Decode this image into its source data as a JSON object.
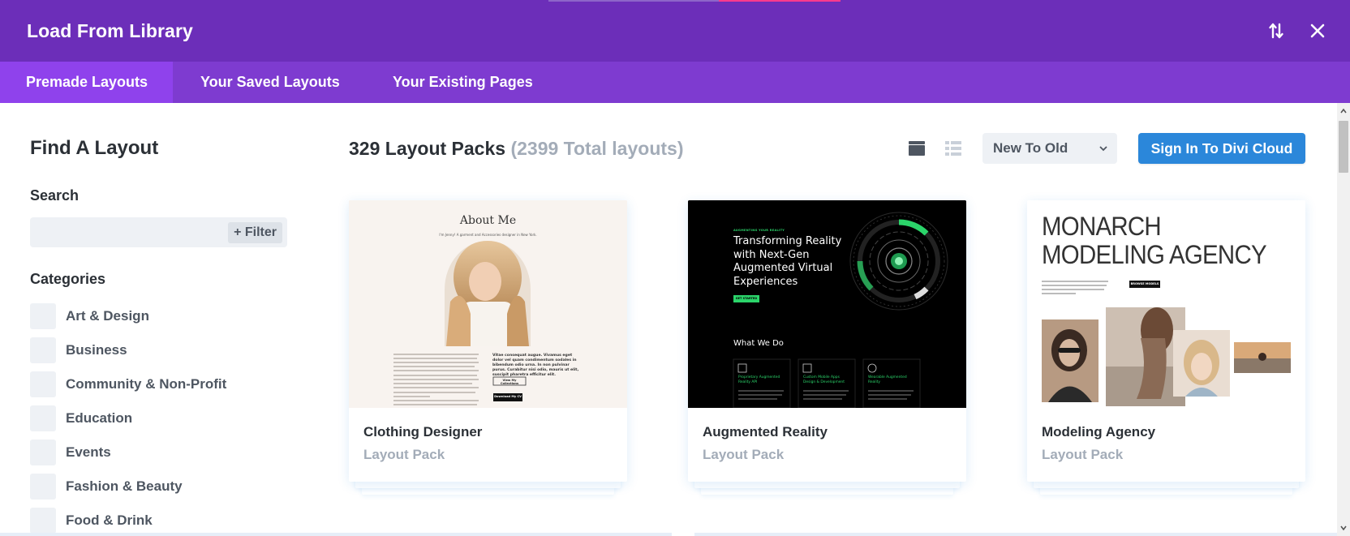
{
  "window": {
    "title": "Load From Library",
    "sort_toggle_icon": "sort-arrows-icon",
    "close_icon": "close-icon"
  },
  "tabs": [
    {
      "label": "Premade Layouts",
      "active": true
    },
    {
      "label": "Your Saved Layouts",
      "active": false
    },
    {
      "label": "Your Existing Pages",
      "active": false
    }
  ],
  "sidebar": {
    "heading": "Find A Layout",
    "search_label": "Search",
    "search_value": "",
    "filter_label": "+ Filter",
    "categories_label": "Categories",
    "categories": [
      {
        "label": "Art & Design",
        "checked": false
      },
      {
        "label": "Business",
        "checked": false
      },
      {
        "label": "Community & Non-Profit",
        "checked": false
      },
      {
        "label": "Education",
        "checked": false
      },
      {
        "label": "Events",
        "checked": false
      },
      {
        "label": "Fashion & Beauty",
        "checked": false
      },
      {
        "label": "Food & Drink",
        "checked": false
      }
    ]
  },
  "main": {
    "pack_count": "329 Layout Packs",
    "total_layouts": "(2399 Total layouts)",
    "views": {
      "grid_icon": "grid-view-icon",
      "list_icon": "list-view-icon",
      "active": "grid"
    },
    "sort": {
      "selected": "New To Old"
    },
    "cloud_button": "Sign In To Divi Cloud",
    "cards": [
      {
        "name": "Clothing Designer",
        "type": "Layout Pack",
        "thumb": {
          "heading": "About Me",
          "sub": "I'm Jenny! A garment and Accessories designer in New York.",
          "side_text": "Vitae consequat augue. Vivamus eget dolor vel quam condimentum sodales in bibendum odio urna. In non pulvinar purus. Curabitur nisi odio, mauris ut elit, suscipit pharetra efficitur elit.",
          "btn1": "View My Collections",
          "btn2": "Download My CV"
        }
      },
      {
        "name": "Augmented Reality",
        "type": "Layout Pack",
        "thumb": {
          "eyebrow": "AUGMENTING YOUR REALITY",
          "headline": [
            "Transforming Reality",
            "with Next-Gen",
            "Augmented Virtual",
            "Experiences"
          ],
          "cta": "GET STARTED",
          "section": "What We Do",
          "features": [
            "Proprietary Augmented Reality API",
            "Custom Mobile Apps Design & Development",
            "Wearable Augmented Reality"
          ]
        }
      },
      {
        "name": "Modeling Agency",
        "type": "Layout Pack",
        "thumb": {
          "headline": [
            "MONARCH",
            "MODELING AGENCY"
          ],
          "cta": "BROWSE MODELS"
        }
      }
    ]
  },
  "colors": {
    "header": "#6c2eb9",
    "tabs": "#7e3bd0",
    "tab_active": "#8f42ec",
    "primary_button": "#2b87da",
    "ar_accent": "#2bd46a"
  }
}
